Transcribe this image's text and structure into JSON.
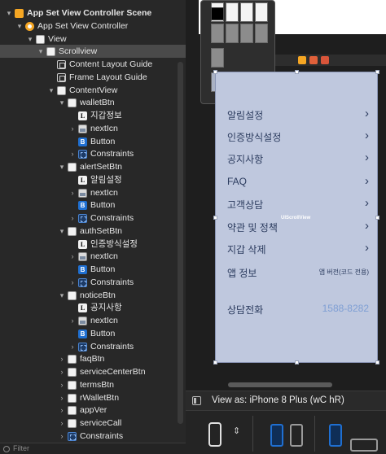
{
  "outline": {
    "rows": [
      {
        "label": "App Set View Controller Scene",
        "indent": 0,
        "disclosure": "open",
        "icon": "scene-icon",
        "selected": false,
        "bold": true
      },
      {
        "label": "App Set View Controller",
        "indent": 1,
        "disclosure": "open",
        "icon": "view-controller-icon",
        "selected": false
      },
      {
        "label": "View",
        "indent": 2,
        "disclosure": "open",
        "icon": "view-icon",
        "selected": false
      },
      {
        "label": "Scrollview",
        "indent": 3,
        "disclosure": "open",
        "icon": "view-icon",
        "selected": true
      },
      {
        "label": "Content Layout Guide",
        "indent": 4,
        "disclosure": "none",
        "icon": "layout-guide-icon",
        "selected": false
      },
      {
        "label": "Frame Layout Guide",
        "indent": 4,
        "disclosure": "none",
        "icon": "layout-guide-icon",
        "selected": false
      },
      {
        "label": "ContentView",
        "indent": 4,
        "disclosure": "open",
        "icon": "view-icon",
        "selected": false
      },
      {
        "label": "walletBtn",
        "indent": 5,
        "disclosure": "open",
        "icon": "view-icon",
        "selected": false
      },
      {
        "label": "지갑정보",
        "indent": 6,
        "disclosure": "none",
        "icon": "label-icon",
        "selected": false
      },
      {
        "label": "nextIcn",
        "indent": 6,
        "disclosure": "closed",
        "icon": "image-view-icon",
        "selected": false
      },
      {
        "label": "Button",
        "indent": 6,
        "disclosure": "none",
        "icon": "button-icon",
        "selected": false
      },
      {
        "label": "Constraints",
        "indent": 6,
        "disclosure": "closed",
        "icon": "constraints-icon",
        "selected": false
      },
      {
        "label": "alertSetBtn",
        "indent": 5,
        "disclosure": "open",
        "icon": "view-icon",
        "selected": false
      },
      {
        "label": "알림설정",
        "indent": 6,
        "disclosure": "none",
        "icon": "label-icon",
        "selected": false
      },
      {
        "label": "nextIcn",
        "indent": 6,
        "disclosure": "closed",
        "icon": "image-view-icon",
        "selected": false
      },
      {
        "label": "Button",
        "indent": 6,
        "disclosure": "none",
        "icon": "button-icon",
        "selected": false
      },
      {
        "label": "Constraints",
        "indent": 6,
        "disclosure": "closed",
        "icon": "constraints-icon",
        "selected": false
      },
      {
        "label": "authSetBtn",
        "indent": 5,
        "disclosure": "open",
        "icon": "view-icon",
        "selected": false
      },
      {
        "label": "인증방식설정",
        "indent": 6,
        "disclosure": "none",
        "icon": "label-icon",
        "selected": false
      },
      {
        "label": "nextIcn",
        "indent": 6,
        "disclosure": "closed",
        "icon": "image-view-icon",
        "selected": false
      },
      {
        "label": "Button",
        "indent": 6,
        "disclosure": "none",
        "icon": "button-icon",
        "selected": false
      },
      {
        "label": "Constraints",
        "indent": 6,
        "disclosure": "closed",
        "icon": "constraints-icon",
        "selected": false
      },
      {
        "label": "noticeBtn",
        "indent": 5,
        "disclosure": "open",
        "icon": "view-icon",
        "selected": false
      },
      {
        "label": "공지사항",
        "indent": 6,
        "disclosure": "none",
        "icon": "label-icon",
        "selected": false
      },
      {
        "label": "nextIcn",
        "indent": 6,
        "disclosure": "closed",
        "icon": "image-view-icon",
        "selected": false
      },
      {
        "label": "Button",
        "indent": 6,
        "disclosure": "none",
        "icon": "button-icon",
        "selected": false
      },
      {
        "label": "Constraints",
        "indent": 6,
        "disclosure": "closed",
        "icon": "constraints-icon",
        "selected": false
      },
      {
        "label": "faqBtn",
        "indent": 5,
        "disclosure": "closed",
        "icon": "view-icon",
        "selected": false
      },
      {
        "label": "serviceCenterBtn",
        "indent": 5,
        "disclosure": "closed",
        "icon": "view-icon",
        "selected": false
      },
      {
        "label": "termsBtn",
        "indent": 5,
        "disclosure": "closed",
        "icon": "view-icon",
        "selected": false
      },
      {
        "label": "rWalletBtn",
        "indent": 5,
        "disclosure": "closed",
        "icon": "view-icon",
        "selected": false
      },
      {
        "label": "appVer",
        "indent": 5,
        "disclosure": "closed",
        "icon": "view-icon",
        "selected": false
      },
      {
        "label": "serviceCall",
        "indent": 5,
        "disclosure": "closed",
        "icon": "view-icon",
        "selected": false
      },
      {
        "label": "Constraints",
        "indent": 5,
        "disclosure": "closed",
        "icon": "constraints-icon",
        "selected": false
      }
    ],
    "label_glyphs": {
      "layout-guide-icon": "",
      "label-icon": "L",
      "button-icon": "B"
    },
    "filter_placeholder": "Filter"
  },
  "canvas": {
    "menu_rows": [
      {
        "label": "알림설정",
        "type": "chevron"
      },
      {
        "label": "인증방식설정",
        "type": "chevron"
      },
      {
        "label": "공지사항",
        "type": "chevron"
      },
      {
        "label": "FAQ",
        "type": "chevron"
      },
      {
        "label": "고객상담",
        "type": "chevron"
      },
      {
        "label": "약관 및 정책",
        "type": "chevron"
      },
      {
        "label": "지갑 삭제",
        "type": "chevron"
      },
      {
        "label": "앱 정보",
        "type": "value",
        "value": "앱 버전(코드 전용)"
      },
      {
        "label": "상담전화",
        "type": "phone",
        "value": "1588-8282"
      }
    ],
    "chevron_glyph": "›",
    "scrollview_tag": "UIScrollView"
  },
  "bottom_bar": {
    "view_as": "View as: iPhone 8 Plus (wC hR)"
  },
  "colors": {
    "selection": "#4a4a4a",
    "phone_bg": "#bfc8de",
    "menu_text": "#2b3b5e",
    "phone_number": "#7f9fd4",
    "device_selected": "#1f6fd1"
  }
}
